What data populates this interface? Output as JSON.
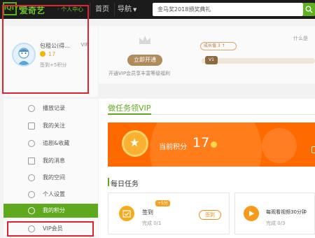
{
  "topbar": {
    "logo": "iQIYI",
    "brand": "爱奇艺",
    "user_center": "· 个人中心",
    "home": "首页",
    "nav": "导航",
    "search_placeholder": "金马奖2018颁奖典礼"
  },
  "profile": {
    "username": "包租公(得...",
    "vip_badge": "VIP",
    "points": "17",
    "sign_info": "签到+5积分"
  },
  "vip": {
    "open_button": "立即开通",
    "description": "开通VIP会员享丰富等级福利",
    "growth": "成长值 3 ↑",
    "help": "什么是",
    "level": "V1"
  },
  "sidebar": {
    "items": [
      {
        "label": "播放记录"
      },
      {
        "label": "我的关注"
      },
      {
        "label": "追剧&收藏"
      },
      {
        "label": "我的消息"
      },
      {
        "label": "我的空间"
      },
      {
        "label": "个人设置"
      },
      {
        "label": "我的积分"
      },
      {
        "label": "VIP会员"
      }
    ]
  },
  "main": {
    "section_title": "做任务领VIP",
    "current_points_label": "当前积分",
    "current_points_value": "17",
    "daily_title": "每日任务",
    "task1": {
      "name": "签到",
      "badge": "+5分",
      "progress": "完成 0/1",
      "button": "签到"
    },
    "task2": {
      "name": "每观看视频30分钟",
      "progress": "完成 0/3"
    }
  },
  "colors": {
    "accent_green": "#5fa91f",
    "banner_orange": "#ff6a00",
    "highlight_red": "#e0242f"
  }
}
